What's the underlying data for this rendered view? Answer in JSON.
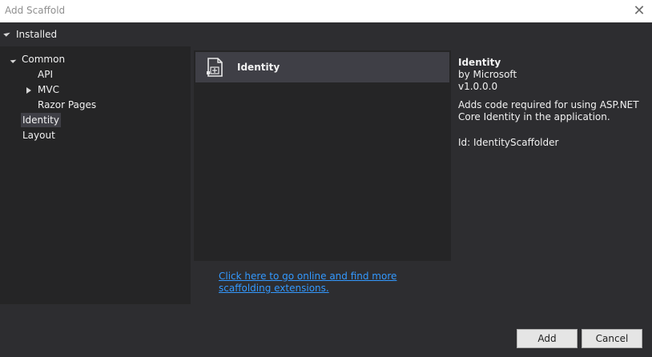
{
  "window": {
    "title": "Add Scaffold",
    "close_glyph": "✕"
  },
  "tree": {
    "root_label": "Installed",
    "items": [
      {
        "label": "Common"
      },
      {
        "label": "API"
      },
      {
        "label": "MVC"
      },
      {
        "label": "Razor Pages"
      },
      {
        "label": "Identity"
      },
      {
        "label": "Layout"
      }
    ]
  },
  "list": {
    "items": [
      {
        "label": "Identity",
        "icon": "scaffold-icon"
      }
    ]
  },
  "details": {
    "title": "Identity",
    "author": "by Microsoft",
    "version": "v1.0.0.0",
    "description": "Adds code required for using ASP.NET Core Identity in the application.",
    "id_line": "Id: IdentityScaffolder"
  },
  "online_link": "Click here to go online and find more scaffolding extensions.",
  "buttons": {
    "add": "Add",
    "cancel": "Cancel"
  },
  "colors": {
    "accent_link": "#3399ff",
    "selected_bg": "#3f3f46",
    "dialog_bg": "#2d2d30"
  }
}
